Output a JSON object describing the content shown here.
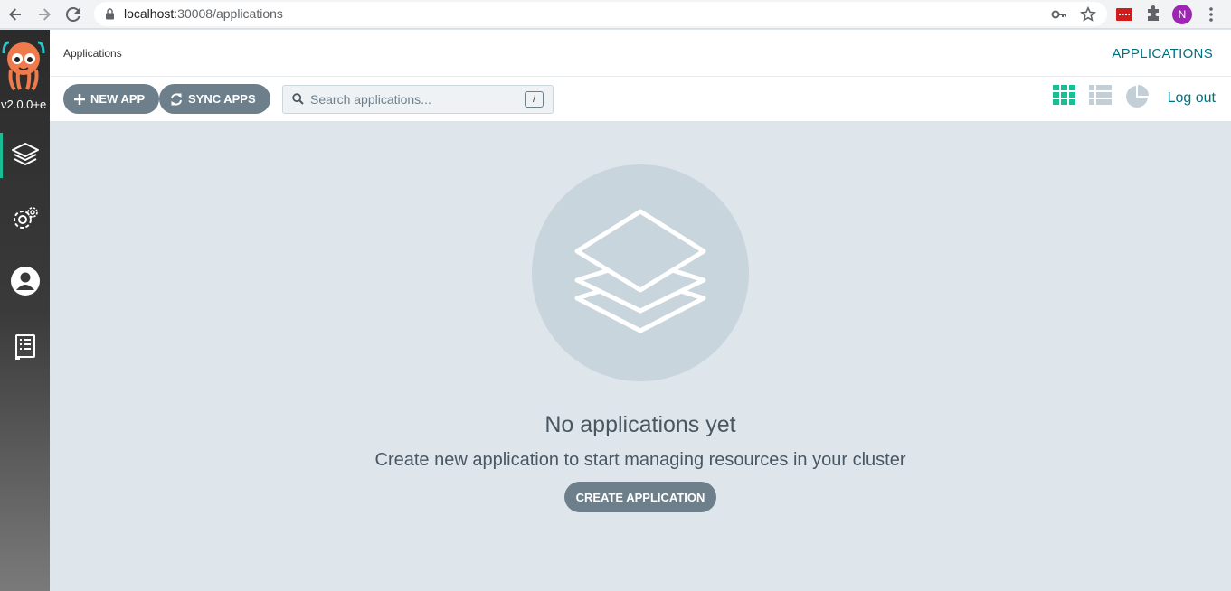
{
  "browser": {
    "url_host": "localhost",
    "url_rest": ":30008/applications",
    "profile_initial": "N"
  },
  "sidebar": {
    "version": "v2.0.0+e",
    "items": [
      {
        "icon": "layers-icon",
        "active": true
      },
      {
        "icon": "gear-icon",
        "active": false
      },
      {
        "icon": "user-icon",
        "active": false
      },
      {
        "icon": "docs-icon",
        "active": false
      }
    ]
  },
  "header": {
    "breadcrumb": "Applications",
    "title": "APPLICATIONS"
  },
  "toolbar": {
    "new_app_label": "NEW APP",
    "sync_apps_label": "SYNC APPS",
    "search_placeholder": "Search applications...",
    "search_shortcut": "/",
    "logout_label": "Log out"
  },
  "empty_state": {
    "title": "No applications yet",
    "subtitle": "Create new application to start managing resources in your cluster",
    "button_label": "CREATE APPLICATION"
  },
  "colors": {
    "accent": "#00717f",
    "tile_active": "#18be94",
    "button": "#6d7f8b",
    "background": "#dee6eb"
  }
}
